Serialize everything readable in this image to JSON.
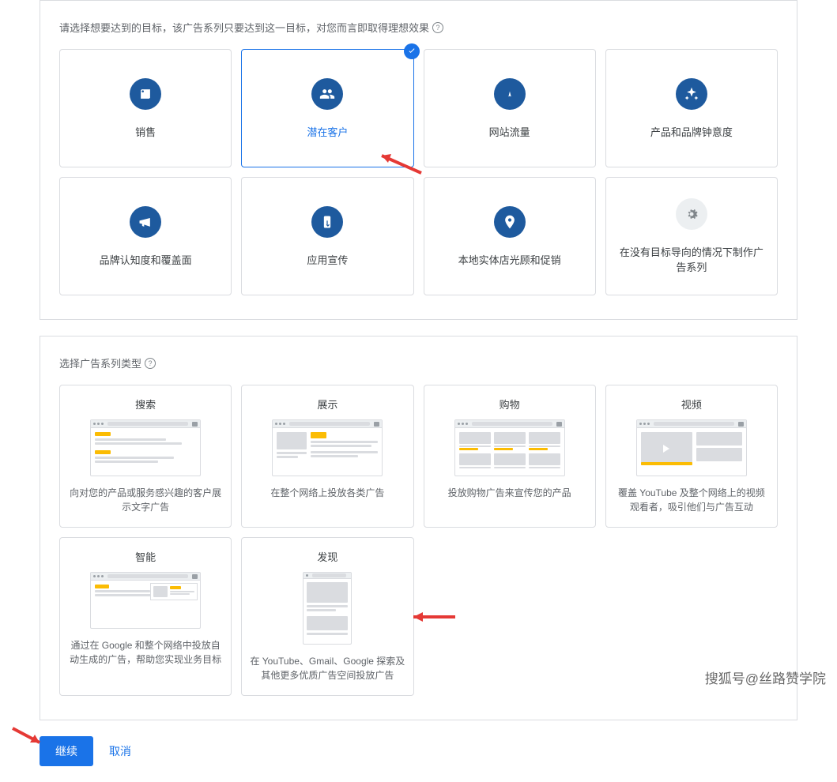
{
  "goals": {
    "title": "请选择想要达到的目标，该广告系列只要达到这一目标，对您而言即取得理想效果",
    "cards": [
      {
        "label": "销售",
        "icon": "tag"
      },
      {
        "label": "潜在客户",
        "icon": "people"
      },
      {
        "label": "网站流量",
        "icon": "click"
      },
      {
        "label": "产品和品牌钟意度",
        "icon": "sparkle"
      },
      {
        "label": "品牌认知度和覆盖面",
        "icon": "megaphone"
      },
      {
        "label": "应用宣传",
        "icon": "app"
      },
      {
        "label": "本地实体店光顾和促销",
        "icon": "pin"
      },
      {
        "label": "在没有目标导向的情况下制作广告系列",
        "icon": "gear"
      }
    ],
    "selected_index": 1
  },
  "types": {
    "title": "选择广告系列类型",
    "cards": [
      {
        "title": "搜索",
        "desc": "向对您的产品或服务感兴趣的客户展示文字广告"
      },
      {
        "title": "展示",
        "desc": "在整个网络上投放各类广告"
      },
      {
        "title": "购物",
        "desc": "投放购物广告来宣传您的产品"
      },
      {
        "title": "视频",
        "desc": "覆盖 YouTube 及整个网络上的视频观看者，吸引他们与广告互动"
      },
      {
        "title": "智能",
        "desc": "通过在 Google 和整个网络中投放自动生成的广告，帮助您实现业务目标"
      },
      {
        "title": "发现",
        "desc": "在 YouTube、Gmail、Google 探索及其他更多优质广告空间投放广告"
      }
    ]
  },
  "actions": {
    "continue": "继续",
    "cancel": "取消"
  },
  "watermark": "搜狐号@丝路赞学院"
}
